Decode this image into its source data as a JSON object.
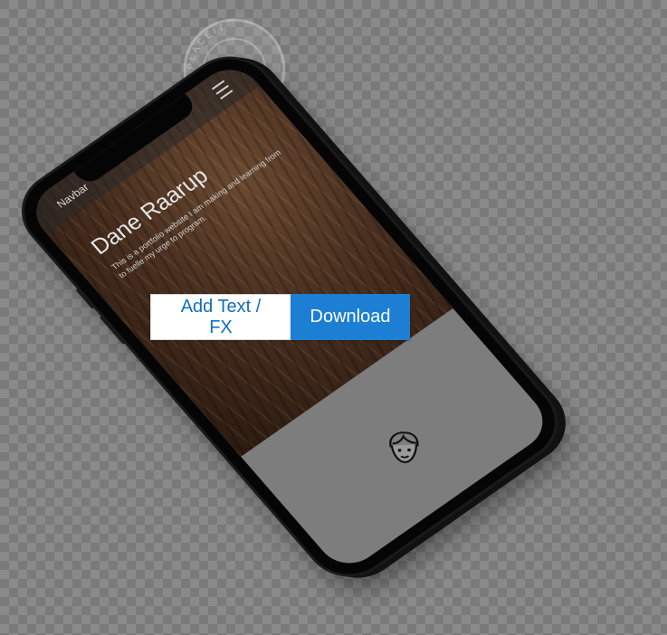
{
  "actions": {
    "add_text_label": "Add Text / FX",
    "download_label": "Download"
  },
  "phone": {
    "navbar_brand": "Navbar",
    "hero_title": "Dane Raarup",
    "hero_text": "This is a portfolio website I am making and learning from to fuelle my urge to program.",
    "menu_icon": "hamburger-icon",
    "avatar_icon": "person-avatar-icon"
  },
  "watermark": {
    "text": "PLACEIT",
    "icon": "watermark-seal-icon"
  },
  "colors": {
    "primary": "#1c7fd3",
    "secondary_text": "#0f6fbd",
    "background_light": "#8a8a8a",
    "background_dark": "#7a7a7a"
  }
}
